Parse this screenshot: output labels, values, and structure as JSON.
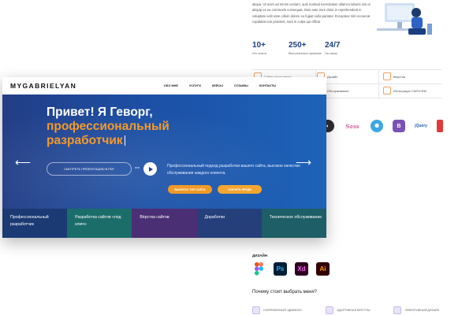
{
  "background_page": {
    "intro_text": "aliqua. Ut enim ad minim veniam, quis nostrud exercitation ullamco laboris nisi ut aliquip ex ea commodo consequat. Duis aute irure dolor in reprehenderit in voluptate velit esse cillum dolore eu fugiat nulla pariatur. Excepteur sint occaecat cupidatat non proident, sunt in culpa qui officia",
    "stats": [
      {
        "value": "10+",
        "label": "Лет опыта"
      },
      {
        "value": "250+",
        "label": "Выполненных проектов"
      },
      {
        "value": "24/7",
        "label": "На связи"
      }
    ],
    "services": [
      {
        "label": "Сайты «под ключ»"
      },
      {
        "label": "Дизайн"
      },
      {
        "label": "Вёрстка"
      },
      {
        "label": "Обслуживание"
      },
      {
        "label": "Интеграции CMS/CRM"
      }
    ],
    "design_title": "ДИЗАЙН",
    "design_apps": [
      "Ps",
      "Xd",
      "Ai"
    ],
    "why_title": "Почему стоит выбрать меня?",
    "why_items": [
      "СОВРЕМЕННЫЙ «ДВИЖОК»",
      "АДАПТИВНАЯ ВЕРСТКА",
      "ЭФФЕКТИВНЫЙ ДИЗАЙН"
    ]
  },
  "site": {
    "logo": "MYGABRIELYAN",
    "menu": [
      "ОБО МНЕ",
      "УСЛУГИ",
      "КЕЙСЫ",
      "ОТЗЫВЫ",
      "КОНТАКТЫ"
    ],
    "headline_line1": "Привет! Я Геворг,",
    "headline_accent_line2": "профессиональный",
    "headline_accent_line3": "разработчик",
    "present_button": "СМОТРЕТЬ ПРЕЗЕНТАЦИЮ В PDF",
    "or_text": "или",
    "description": "Профессиональный подход разработки вашего сайта, высокое качество обслуживания каждого клиента.",
    "cta_primary": "ВЫБРАТЬ ТИП САЙТА",
    "cta_secondary": "СКАЧАТЬ КРЕДИ",
    "tiles": [
      {
        "label": "Профессиональный разработчик",
        "color": "#1b3a74"
      },
      {
        "label": "Разработка сайтов «под ключ»",
        "color": "#1b6d6a"
      },
      {
        "label": "Вёрстка сайтов",
        "color": "#4a2f74"
      },
      {
        "label": "Доработки",
        "color": "#243f7a"
      },
      {
        "label": "Техническое обслуживание",
        "color": "#1e5e66"
      }
    ]
  },
  "colors": {
    "accent": "#f39a2b",
    "hero_blue": "#1c50a6",
    "stat_blue": "#1c3f82"
  }
}
